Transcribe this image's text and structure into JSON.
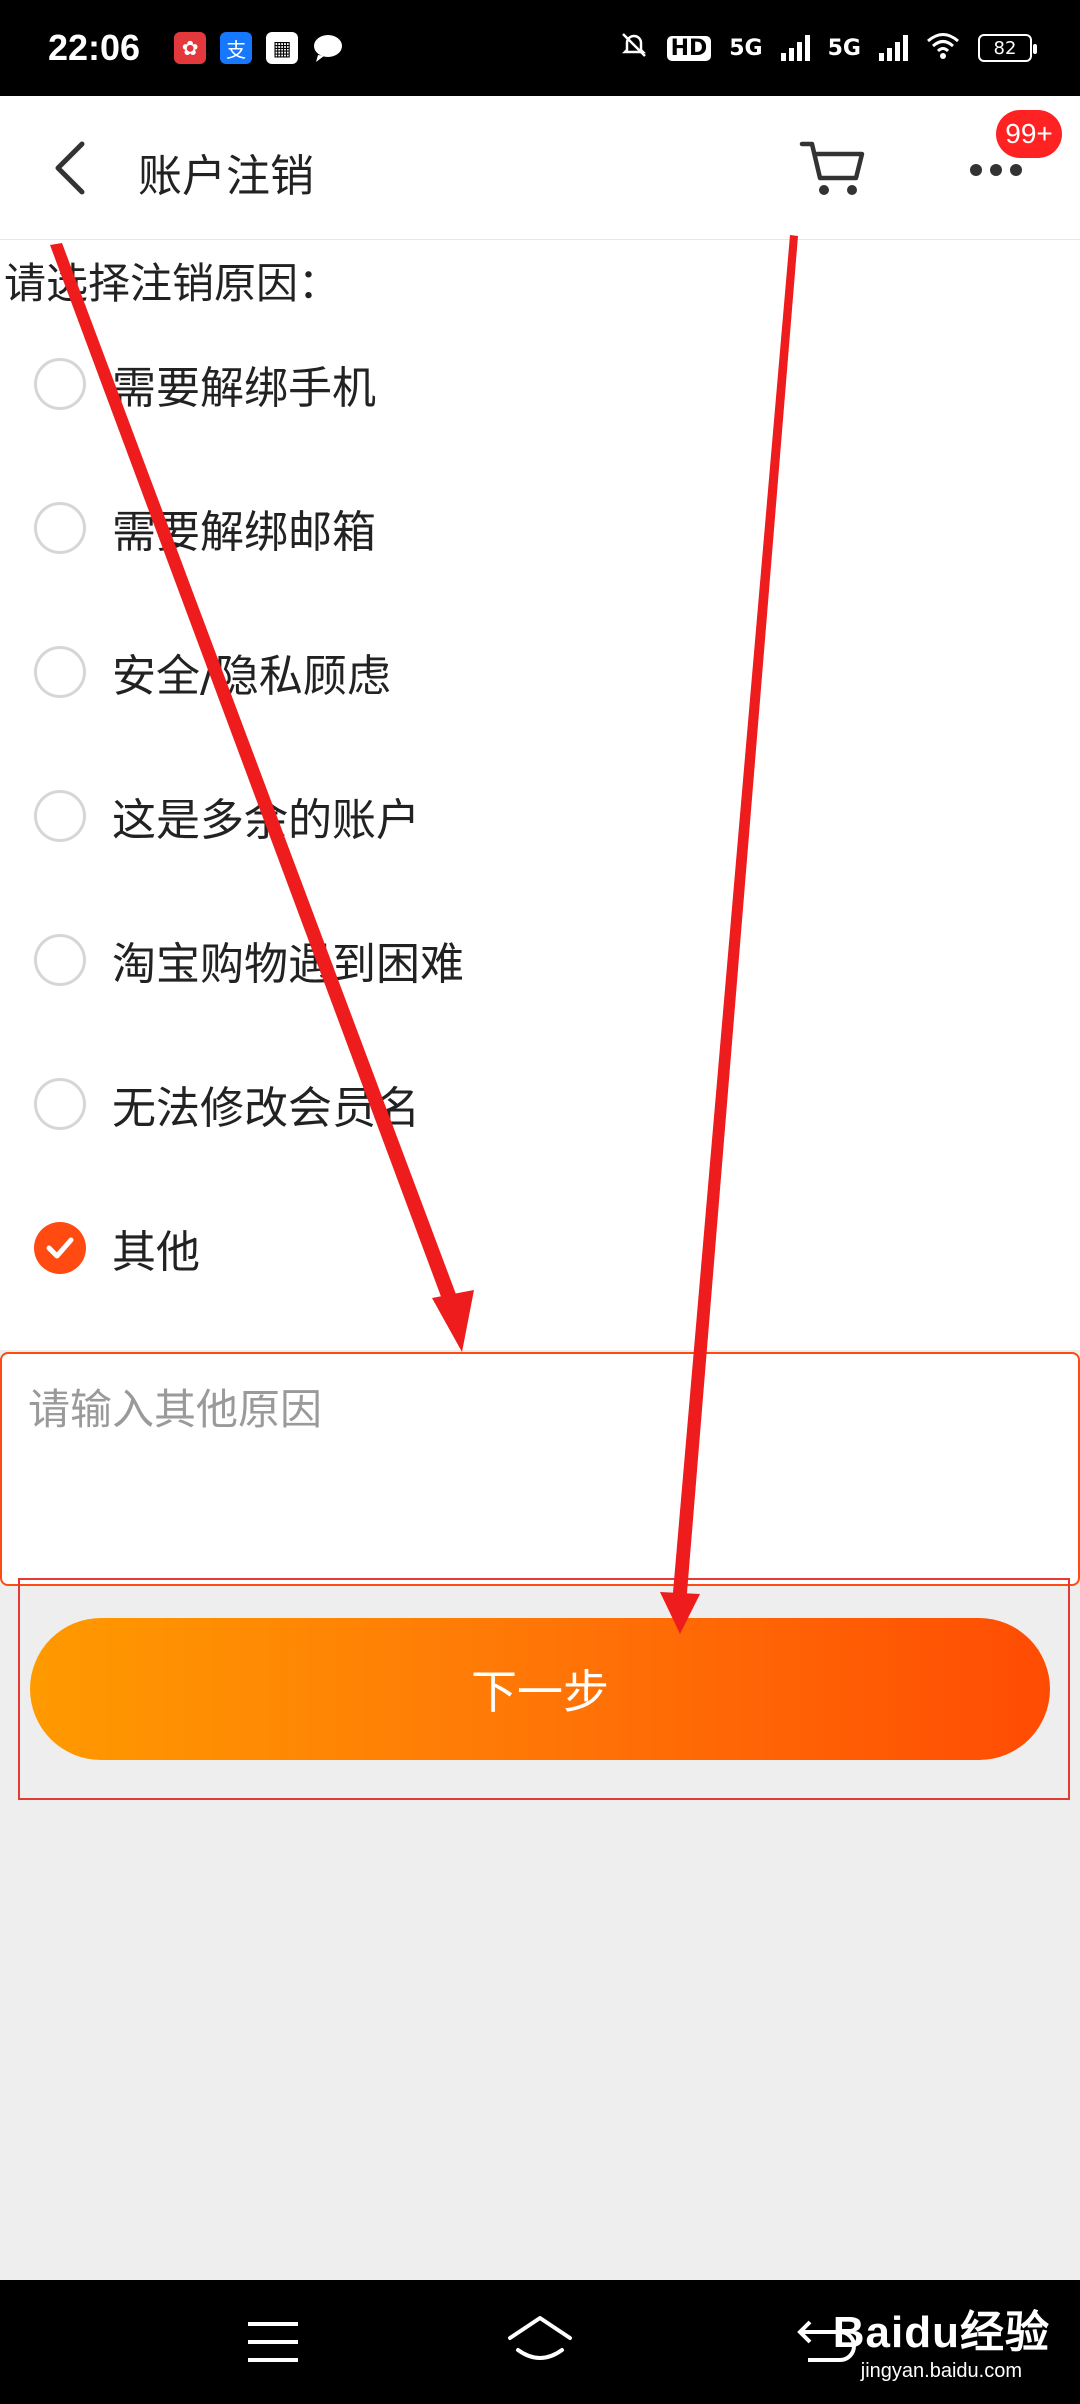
{
  "status_bar": {
    "time": "22:06",
    "hd_label": "HD",
    "network_1": "5G",
    "network_2": "5G",
    "battery": "82"
  },
  "header": {
    "title": "账户注销",
    "badge": "99+"
  },
  "form": {
    "prompt": "请选择注销原因：",
    "reasons": [
      {
        "label": "需要解绑手机",
        "checked": false
      },
      {
        "label": "需要解绑邮箱",
        "checked": false
      },
      {
        "label": "安全/隐私顾虑",
        "checked": false
      },
      {
        "label": "这是多余的账户",
        "checked": false
      },
      {
        "label": "淘宝购物遇到困难",
        "checked": false
      },
      {
        "label": "无法修改会员名",
        "checked": false
      },
      {
        "label": "其他",
        "checked": true
      }
    ],
    "other_placeholder": "请输入其他原因",
    "next_label": "下一步"
  },
  "watermark": {
    "title": "Baidu经验",
    "url": "jingyan.baidu.com"
  },
  "colors": {
    "accent": "#ff4a12",
    "button_start": "#ff9a00",
    "button_end": "#ff4c04",
    "annotation": "#e53935"
  }
}
